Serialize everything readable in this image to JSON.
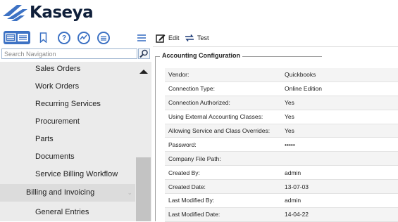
{
  "logo": {
    "text": "Kaseya"
  },
  "search": {
    "placeholder": "Search Navigation"
  },
  "sidebar": {
    "items": [
      {
        "label": "Sales Orders",
        "type": "child"
      },
      {
        "label": "Work Orders",
        "type": "child"
      },
      {
        "label": "Recurring Services",
        "type": "child"
      },
      {
        "label": "Procurement",
        "type": "child"
      },
      {
        "label": "Parts",
        "type": "child"
      },
      {
        "label": "Documents",
        "type": "child"
      },
      {
        "label": "Service Billing Workflow",
        "type": "child"
      },
      {
        "label": "Billing and Invoicing",
        "type": "parent"
      },
      {
        "label": "General Entries",
        "type": "child"
      }
    ]
  },
  "toolbar": {
    "edit_label": "Edit",
    "test_label": "Test"
  },
  "section": {
    "title": "Accounting Configuration"
  },
  "config": {
    "rows": [
      {
        "key": "Vendor:",
        "value": "Quickbooks"
      },
      {
        "key": "Connection Type:",
        "value": "Online Edition"
      },
      {
        "key": "Connection Authorized:",
        "value": "Yes"
      },
      {
        "key": "Using External Accounting Classes:",
        "value": "Yes"
      },
      {
        "key": "Allowing Service and Class Overrides:",
        "value": "Yes"
      },
      {
        "key": "Password:",
        "value": "•••••"
      },
      {
        "key": "Company File Path:",
        "value": ""
      },
      {
        "key": "Created By:",
        "value": "admin"
      },
      {
        "key": "Created Date:",
        "value": "13-07-03"
      },
      {
        "key": "Last Modified By:",
        "value": "admin"
      },
      {
        "key": "Last Modified Date:",
        "value": "14-04-22"
      }
    ]
  },
  "colors": {
    "accent": "#3d72c4",
    "logo_text": "#0f1f3a",
    "sidebar_bg": "#ebebeb"
  }
}
